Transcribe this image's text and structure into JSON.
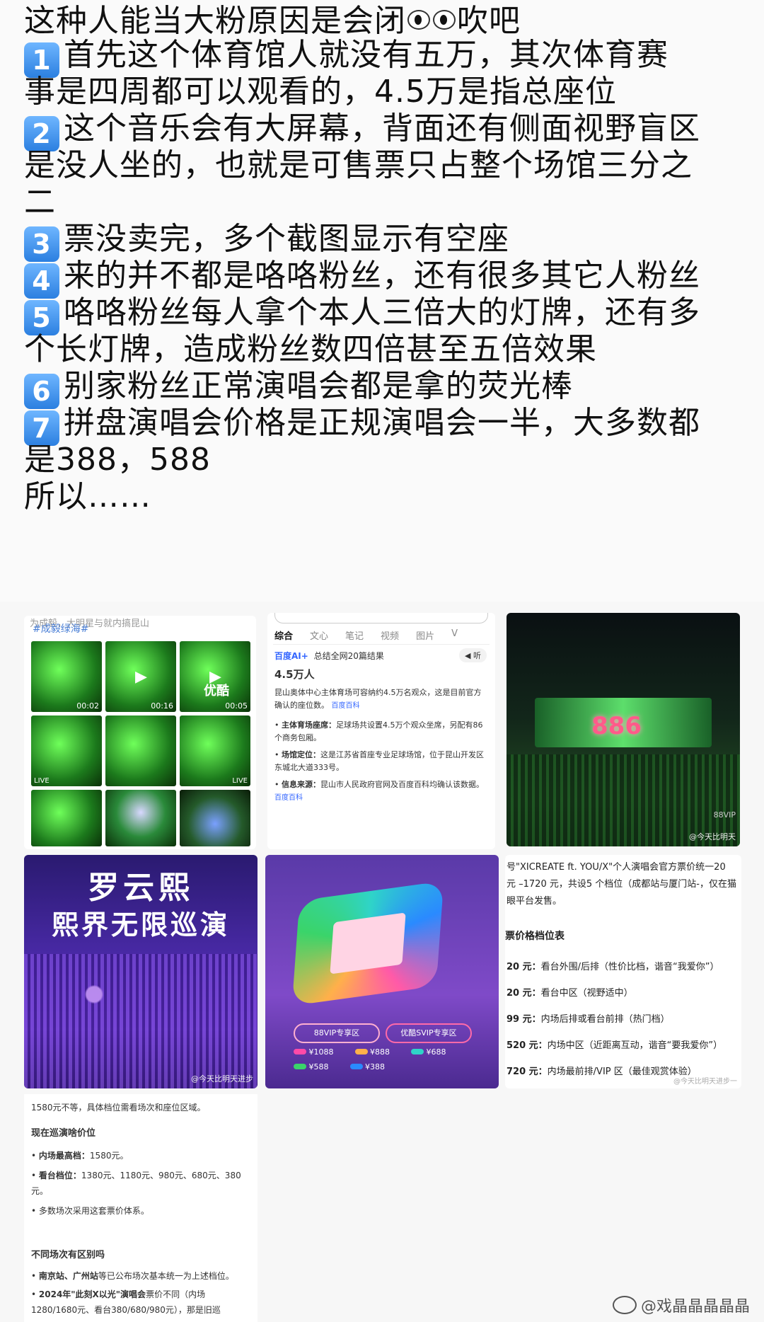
{
  "post": {
    "lines": [
      {
        "num": "",
        "text_before": "这种人能当大粉原因是会闭",
        "text_after": "吹吧"
      },
      {
        "num": "1",
        "text": "首先这个体育馆人就没有五万，其次体育赛"
      },
      {
        "num": "",
        "text": "事是四周都可以观看的，4.5万是指总座位"
      },
      {
        "num": "2",
        "text": "这个音乐会有大屏幕，背面还有侧面视野盲区"
      },
      {
        "num": "",
        "text": "是没人坐的，也就是可售票只占整个场馆三分之"
      },
      {
        "num": "",
        "text": "二"
      },
      {
        "num": "3",
        "text": "票没卖完，多个截图显示有空座"
      },
      {
        "num": "4",
        "text": "来的并不都是咯咯粉丝，还有很多其它人粉丝"
      },
      {
        "num": "5",
        "text": "咯咯粉丝每人拿个本人三倍大的灯牌，还有多"
      },
      {
        "num": "",
        "text": "个长灯牌，造成粉丝数四倍甚至五倍效果"
      },
      {
        "num": "6",
        "text": "别家粉丝正常演唱会都是拿的荧光棒"
      },
      {
        "num": "7",
        "text": "拼盘演唱会价格是正规演唱会一半，大多数都"
      },
      {
        "num": "",
        "text": "是388，588"
      },
      {
        "num": "",
        "text": "所以……"
      }
    ]
  },
  "images": {
    "img1": {
      "hashtag": "#成毅绿海#",
      "top_text": "为成毅，大明星与就内搞昆山",
      "timestamps": [
        "00:02",
        "00:16",
        "00:05"
      ],
      "youku": "优酷",
      "live": "LIVE"
    },
    "img2": {
      "tabs": [
        "综合",
        "文心",
        "笔记",
        "视频",
        "图片",
        "V"
      ],
      "ai_label": "百度AI+",
      "ai_summary": "总结全网20篇结果",
      "listen": "听",
      "answer": "4.5万人",
      "intro": "昆山奥体中心主体育场可容纳约4.5万名观众，这是目前官方确认的座位数。",
      "source": "百度百科",
      "bullets": [
        {
          "title": "主体育场座席：",
          "text": "足球场共设置4.5万个观众坐席，另配有86个商务包厢。"
        },
        {
          "title": "场馆定位：",
          "text": "这是江苏省首座专业足球场馆，位于昆山开发区东城北大道333号。"
        },
        {
          "title": "信息来源：",
          "text": "昆山市人民政府官网及百度百科均确认该数据。"
        }
      ],
      "source2": "百度百科"
    },
    "img3": {
      "screen": "886",
      "tag": "88VIP",
      "watermark": "@今天比明天"
    },
    "img4": {
      "line1": "罗云熙",
      "line2": "熙界无限巡演",
      "watermark": "@今天比明天进步"
    },
    "img5": {
      "zone1": "88VIP专享区",
      "zone2": "优酷SVIP专享区",
      "prices": [
        "¥1088",
        "¥888",
        "¥688",
        "¥588",
        "¥388"
      ]
    },
    "img6": {
      "header": "号\"XICREATE ft. YOU/X\"个人演唱会官方票价统一20 元 –1720 元，共设5 个档位（成都站与厦门站-，仅在猫眼平台发售。",
      "title": "票价格档位表",
      "rows": [
        {
          "price": "20 元：",
          "desc": "看台外围/后排（性价比档，谐音“我爱你”）"
        },
        {
          "price": "20 元：",
          "desc": "看台中区（视野适中）"
        },
        {
          "price": "99 元：",
          "desc": "内场后排或看台前排（热门档）"
        },
        {
          "price": "520 元：",
          "desc": "内场中区（近距离互动，谐音“要我爱你”）"
        },
        {
          "price": "720 元：",
          "desc": "内场最前排/VIP 区（最佳观赏体验）"
        }
      ],
      "watermark": "@今天比明天进步一"
    },
    "img7": {
      "top": "1580元不等，具体档位需看场次和座位区域。",
      "h1": "现在巡演啥价位",
      "b1_title": "内场最高档：",
      "b1": "1580元。",
      "b2_title": "看台档位：",
      "b2": "1380元、1180元、980元、680元、380元。",
      "b3": "多数场次采用这套票价体系。",
      "h2": "不同场次有区别吗",
      "b4_title": "南京站、广州站",
      "b4": "等已公布场次基本统一为上述档位。",
      "b5_title": "2024年\"此刻X以光\"演唱会",
      "b5": "票价不同（内场1280/1680元、看台380/680/980元），那是旧巡"
    }
  },
  "watermark": "@戏晶晶晶晶晶",
  "colors": {
    "num_badge": "#3a8ef0",
    "green": "#1c7a1c",
    "purple": "#4a2aa8"
  }
}
